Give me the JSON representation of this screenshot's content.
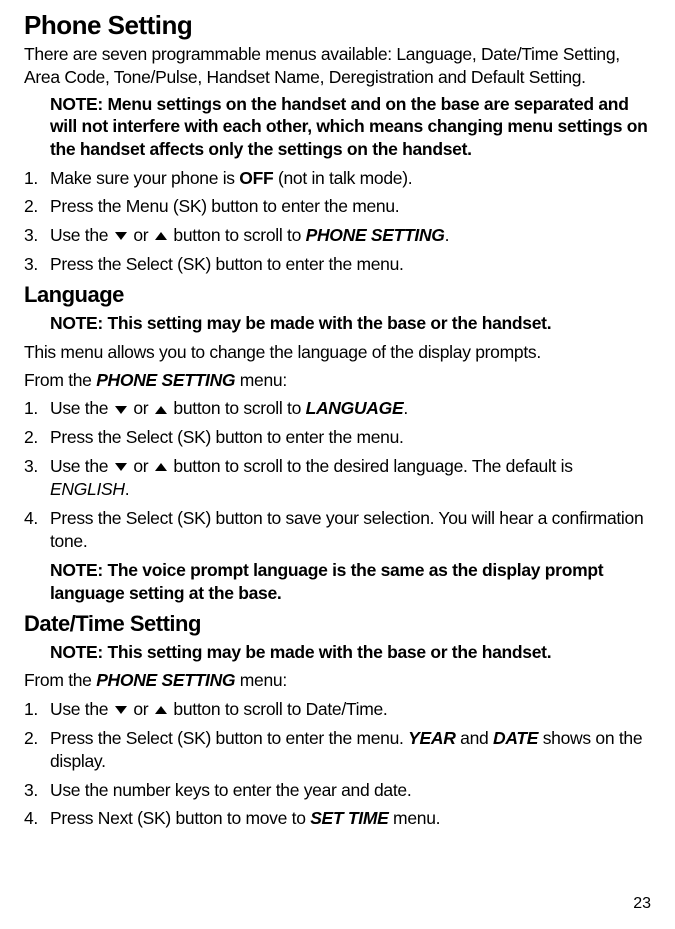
{
  "page_number": "23",
  "h1": "Phone Setting",
  "intro": "There are seven programmable menus available: Language, Date/Time Setting, Area Code, Tone/Pulse, Handset Name, Deregistration and Default Setting.",
  "note1": "NOTE: Menu settings on the handset and on the base are separated and will not interfere with each other, which means changing menu settings on the handset affects only the settings on the handset.",
  "top_steps": {
    "s1_pre": "Make sure your phone is ",
    "s1_bold": "OFF",
    "s1_post": " (not in talk mode).",
    "s2": "Press the Menu (SK) button to enter the menu.",
    "s3_pre": "Use the ",
    "s3_mid": " or ",
    "s3_post": " button to scroll to ",
    "s3_target": "PHONE SETTING",
    "s3_end": ".",
    "s4": "Press the Select (SK) button to enter the menu."
  },
  "h2_lang": "Language",
  "note_lang": "NOTE: This setting may be made with the base or the handset.",
  "lang_intro": "This menu allows you to change the language of the display prompts.",
  "from_menu_pre": "From the ",
  "from_menu_target": "PHONE SETTING",
  "from_menu_post": " menu:",
  "lang_steps": {
    "s1_pre": "Use the ",
    "s1_mid": " or ",
    "s1_post": "  button to scroll to ",
    "s1_target": "LANGUAGE",
    "s1_end": ".",
    "s2": "Press the Select (SK) button to enter the menu.",
    "s3_pre": "Use the ",
    "s3_mid": " or ",
    "s3_post": "  button to scroll to the desired language. The default is ",
    "s3_default": "ENGLISH",
    "s3_end": ".",
    "s4": "Press the Select (SK) button to save your selection. You will hear a confirmation tone."
  },
  "note_voice": "NOTE: The voice prompt language is the same as the display prompt language setting at the base.",
  "h2_date": "Date/Time Setting",
  "note_date": "NOTE: This setting may be made with the base or the handset.",
  "date_steps": {
    "s1_pre": "Use the ",
    "s1_mid": " or ",
    "s1_post": " button to scroll to Date/Time.",
    "s2_pre": "Press the Select (SK) button to enter the menu. ",
    "s2_year": "YEAR",
    "s2_and": " and ",
    "s2_date": "DATE",
    "s2_post": " shows on the display.",
    "s3": "Use the number keys to enter the year and date.",
    "s4_pre": "Press Next (SK) button to move to ",
    "s4_target": "SET TIME",
    "s4_post": " menu."
  }
}
